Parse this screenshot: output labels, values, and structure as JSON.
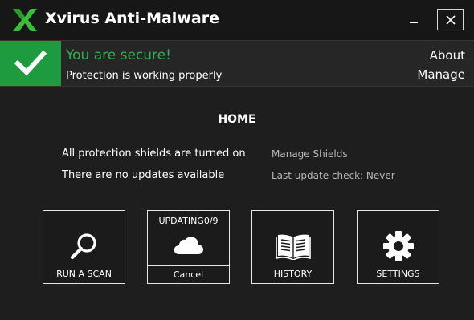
{
  "app": {
    "title": "Xvirus Anti-Malware",
    "brand_color": "#3dbb3d",
    "background_color": "#1e1e1e"
  },
  "window_controls": {
    "minimize_icon": "minimize-icon",
    "close_icon": "close-icon"
  },
  "status": {
    "icon": "checkmark-icon",
    "title": "You are secure!",
    "subtitle": "Protection is working properly",
    "title_color": "#2fb24f",
    "icon_bg_color": "#1f9b3f",
    "about_label": "About",
    "manage_label": "Manage"
  },
  "home": {
    "heading": "HOME",
    "shields_status": "All protection shields are turned on",
    "shields_link": "Manage Shields",
    "updates_status": "There are no updates available",
    "last_update": "Last update check: Never"
  },
  "tiles": {
    "scan": {
      "label": "RUN A SCAN",
      "icon": "magnifier-icon"
    },
    "update": {
      "label": "UPDATING0/9",
      "icon": "cloud-icon",
      "cancel_label": "Cancel"
    },
    "history": {
      "label": "HISTORY",
      "icon": "book-icon"
    },
    "settings": {
      "label": "SETTINGS",
      "icon": "gear-icon"
    }
  }
}
